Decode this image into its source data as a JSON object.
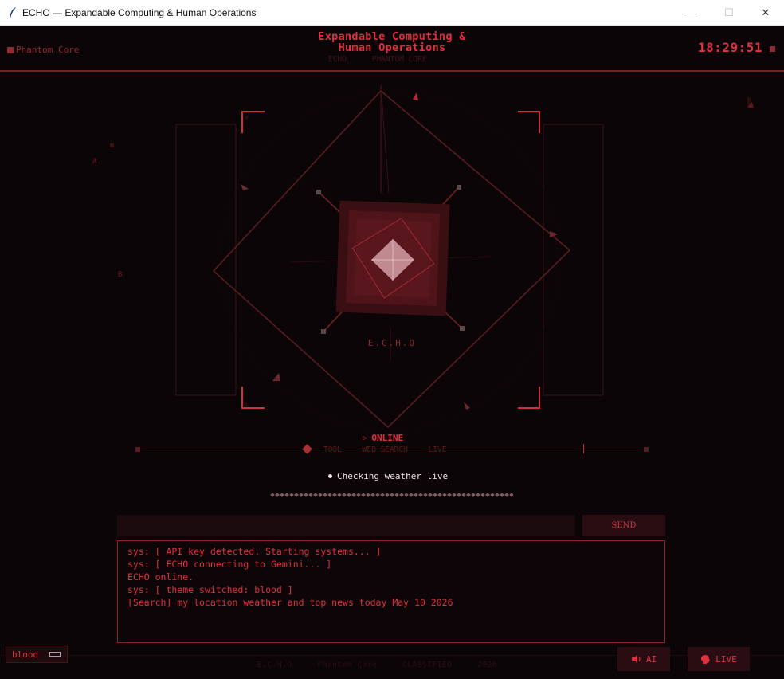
{
  "window": {
    "title": "ECHO — Expandable Computing & Human Operations",
    "minimize_glyph": "—",
    "maximize_glyph": "☐",
    "close_glyph": "✕"
  },
  "header": {
    "brand": "Phantom Core",
    "title_line1": "Expandable Computing &",
    "title_line2": "Human Operations",
    "tabs": [
      "ECHO",
      "PHANTOM CORE"
    ],
    "clock": "18:29:51"
  },
  "hud": {
    "core_label": "E.C.H.O",
    "side_label_a": "A",
    "side_label_b": "B",
    "bracket_label_tl": "F",
    "bracket_label_bl": "L"
  },
  "status": {
    "state": "ONLINE",
    "mode_tags": [
      "TOOL",
      "·",
      "WEB SEARCH",
      "·",
      "LIVE"
    ],
    "activity": "Checking weather live"
  },
  "input": {
    "value": "",
    "placeholder": "",
    "send_label": "SEND"
  },
  "log": {
    "lines": [
      "sys: [ API key detected. Starting systems... ]",
      "sys: [ ECHO connecting to Gemini... ]",
      "ECHO online.",
      "sys: [ theme switched: blood ]",
      "[Search] my location weather and top news today May 10 2026"
    ]
  },
  "footer": {
    "theme": "blood",
    "meta": [
      "E.C.H.O",
      "Phantom Core",
      "CLASSIFIED",
      "2026"
    ],
    "ai_label": "AI",
    "live_label": "LIVE"
  },
  "colors": {
    "accent": "#e0303f",
    "dim": "#7a1c24",
    "background": "#0b0507"
  },
  "icons": {
    "app": "feather-icon",
    "ai": "speaker-icon",
    "live": "head-icon"
  }
}
